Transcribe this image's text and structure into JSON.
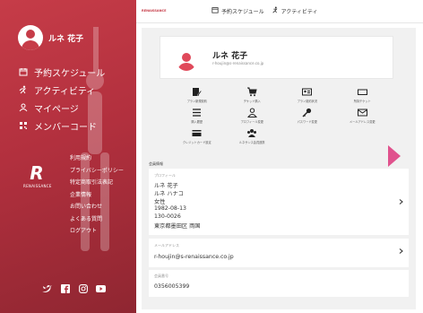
{
  "colors": {
    "accent_red": "#c63c48",
    "arrow_pink": "#e0528d",
    "panel_gray": "#f1f1f1"
  },
  "sidebar": {
    "user_name": "ルネ 花子",
    "nav": [
      {
        "label": "予約スケジュール",
        "icon": "calendar-icon"
      },
      {
        "label": "アクティビティ",
        "icon": "run-icon"
      },
      {
        "label": "マイページ",
        "icon": "person-icon"
      },
      {
        "label": "メンバーコード",
        "icon": "qr-icon"
      }
    ],
    "brand": "RENAISSANCE",
    "links": [
      "利用規約",
      "プライバシーポリシー",
      "特定商取引法表記",
      "企業情報",
      "お問い合わせ",
      "よくある質問",
      "ログアウト"
    ],
    "social": [
      "twitter-icon",
      "facebook-icon",
      "instagram-icon",
      "youtube-icon"
    ]
  },
  "header": {
    "logo": "RENAISSANCE",
    "nav": [
      {
        "label": "予約スケジュール",
        "icon": "calendar-icon"
      },
      {
        "label": "アクティビティ",
        "icon": "run-icon"
      }
    ]
  },
  "profile": {
    "name": "ルネ 花子",
    "email": "r-houjin@s-renaissance.co.jp"
  },
  "grid": [
    {
      "label": "プラン新規契約",
      "icon": "contract-icon"
    },
    {
      "label": "チケット購入",
      "icon": "cart-icon"
    },
    {
      "label": "プラン契約状況",
      "icon": "id-card-icon"
    },
    {
      "label": "所持チケット",
      "icon": "ticket-icon"
    },
    {
      "label": "購入履歴",
      "icon": "list-icon"
    },
    {
      "label": "プロフィール変更",
      "icon": "person-icon"
    },
    {
      "label": "パスワード変更",
      "icon": "key-icon"
    },
    {
      "label": "メールアドレス変更",
      "icon": "mail-icon"
    },
    {
      "label": "クレジットカード設定",
      "icon": "credit-card-icon"
    },
    {
      "label": "ルネサンス会員連携",
      "icon": "group-icon"
    }
  ],
  "member_info": {
    "section_title": "会員情報",
    "profile_label": "プロフィール",
    "profile_lines": [
      "ルネ 花子",
      "ルネ ハナコ",
      "女性",
      "1982-08-13",
      "130-0026",
      "東京都墨田区 両国"
    ],
    "email_label": "メールアドレス",
    "email_value": "r-houjin@s-renaissance.co.jp",
    "member_label": "会員番号",
    "member_value": "0356005399"
  }
}
